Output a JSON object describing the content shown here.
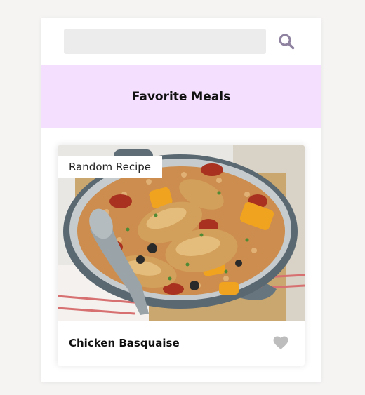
{
  "search": {
    "value": "",
    "placeholder": ""
  },
  "header": {
    "search_icon": "search-icon"
  },
  "favorites": {
    "title": "Favorite Meals"
  },
  "meal": {
    "tag": "Random Recipe",
    "name": "Chicken Basquaise",
    "image": "chicken-basquaise-photo",
    "favorite_icon": "heart-icon",
    "favorited": false
  },
  "colors": {
    "page_bg": "#f5f4f3",
    "fav_bar": "#f4dffe",
    "search_bg": "#ececec",
    "icon_purple": "#8e82a0",
    "heart_grey": "#bdbdbd"
  }
}
